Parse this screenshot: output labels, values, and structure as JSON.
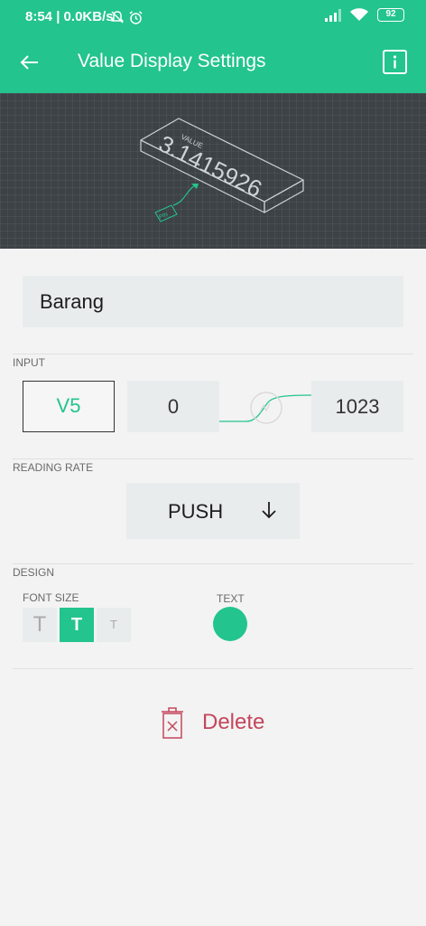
{
  "status_bar": {
    "time": "8:54 | 0.0KB/s",
    "battery": "92"
  },
  "app_bar": {
    "title": "Value Display Settings"
  },
  "preview": {
    "label": "VALUE",
    "value": "3.1415926",
    "pin_label": "PIN"
  },
  "name_field": {
    "value": "Barang"
  },
  "input": {
    "section_label": "INPUT",
    "pin": "V5",
    "min": "0",
    "max": "1023"
  },
  "reading_rate": {
    "section_label": "READING RATE",
    "value": "PUSH"
  },
  "design": {
    "section_label": "DESIGN",
    "font_size_label": "FONT SIZE",
    "font_size_options": [
      "T",
      "T",
      "T"
    ],
    "font_size_selected_index": 1,
    "text_label": "TEXT",
    "text_color": "#23c48e"
  },
  "delete": {
    "label": "Delete"
  },
  "colors": {
    "accent": "#23c48e",
    "danger": "#c4465c",
    "preview_bg": "#3d4247"
  }
}
